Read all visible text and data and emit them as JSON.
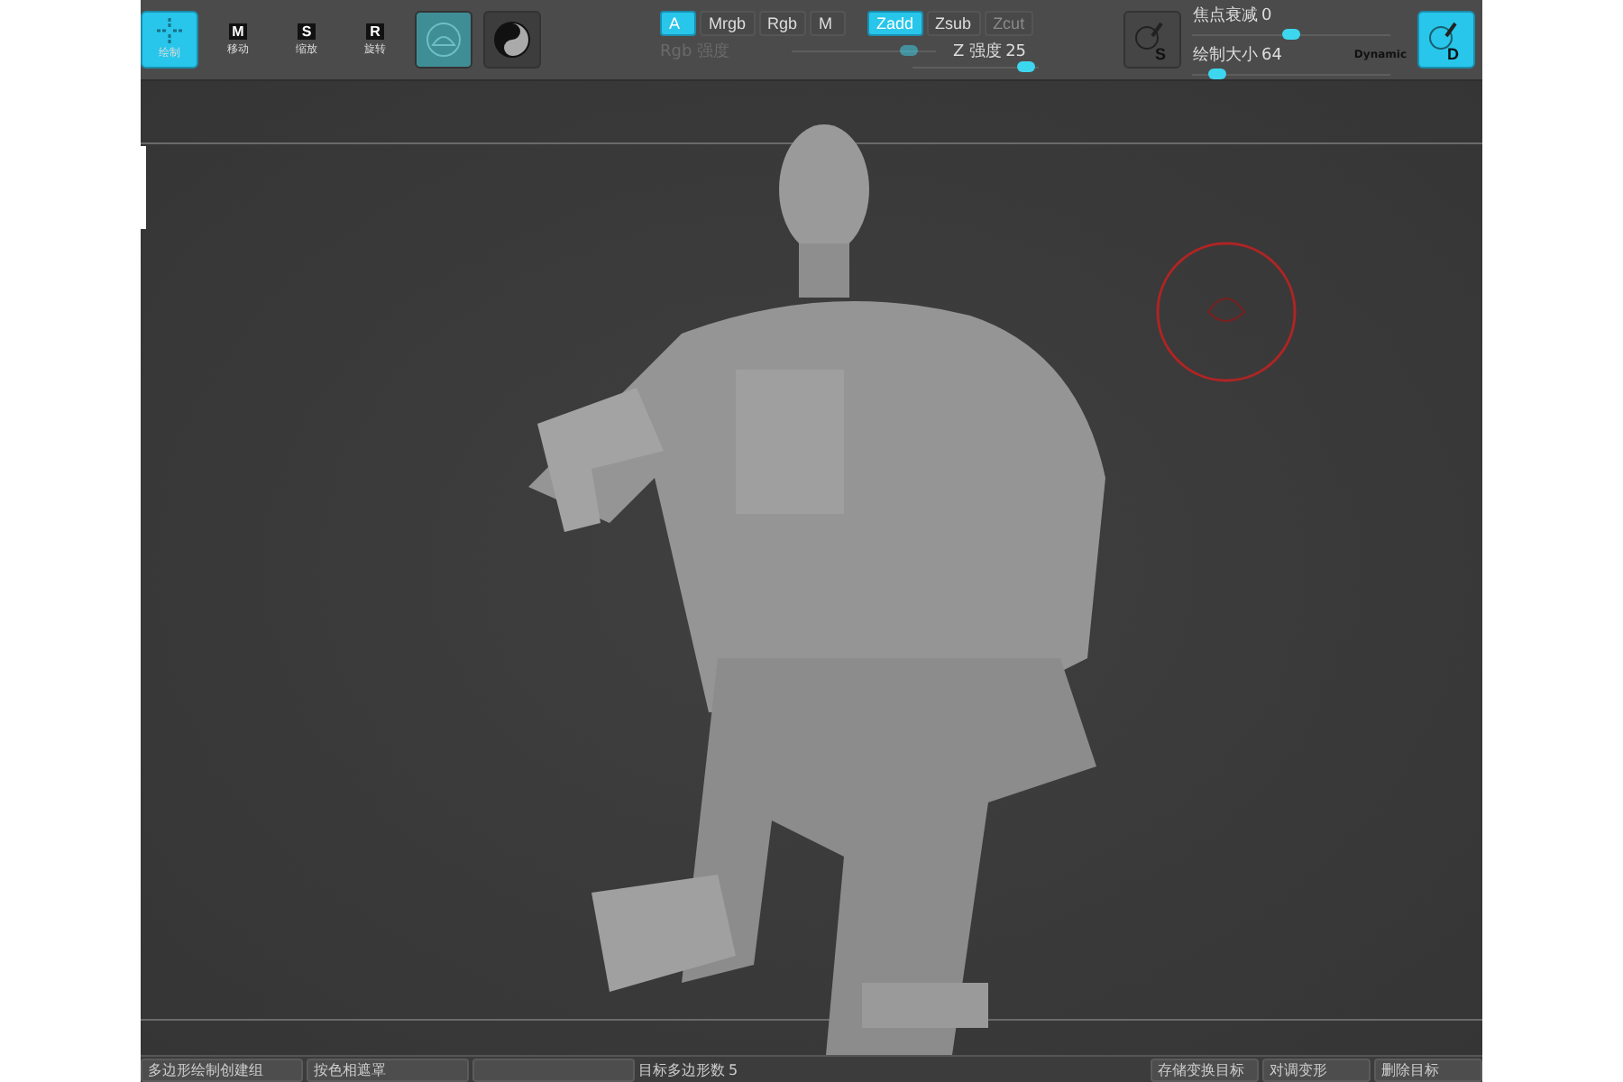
{
  "tools": [
    {
      "kind": "draw",
      "label": "绘制",
      "selected": true
    },
    {
      "kind": "keyed",
      "key": "M",
      "label": "移动",
      "selected": false
    },
    {
      "kind": "keyed",
      "key": "S",
      "label": "缩放",
      "selected": false
    },
    {
      "kind": "keyed",
      "key": "R",
      "label": "旋转",
      "selected": false
    }
  ],
  "spheres": [
    {
      "kind": "sphere",
      "selected": true
    },
    {
      "kind": "yin",
      "selected": false
    }
  ],
  "modes_row1": [
    {
      "label": "A",
      "selected": true,
      "disabled": false
    },
    {
      "label": "Mrgb",
      "selected": false,
      "disabled": false
    },
    {
      "label": "Rgb",
      "selected": false,
      "disabled": false
    },
    {
      "label": "M",
      "selected": false,
      "disabled": false
    }
  ],
  "modes_row2": [
    {
      "label": "Zadd",
      "selected": true,
      "disabled": false
    },
    {
      "label": "Zsub",
      "selected": false,
      "disabled": false
    },
    {
      "label": "Zcut",
      "selected": false,
      "disabled": true
    }
  ],
  "rgb_intensity": {
    "label": "Rgb 强度",
    "disabled": true,
    "level": 0.82
  },
  "z_intensity": {
    "label": "Z 强度",
    "value": "25",
    "level": 0.9
  },
  "stroke_button": {
    "key": "S"
  },
  "focal": {
    "label": "焦点衰减",
    "value": "0",
    "level": 0.5
  },
  "draw_size": {
    "label": "绘制大小",
    "value": "64",
    "level": 0.12
  },
  "dynamic": "Dynamic",
  "draw_button": {
    "key": "D",
    "selected": true
  },
  "bottom_left": [
    "多边形绘制创建组",
    "按色相遮罩"
  ],
  "target_polys": {
    "label": "目标多边形数",
    "value": "5"
  },
  "bottom_right": [
    "存储变换目标",
    "对调变形",
    "删除目标"
  ]
}
